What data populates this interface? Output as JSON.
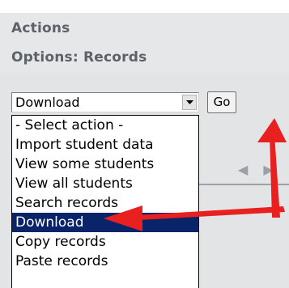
{
  "panel": {
    "title": "Actions",
    "subtitle": "Options: Records"
  },
  "action_select": {
    "current_value": "Download",
    "options": [
      "- Select action -",
      "Import student data",
      "View some students",
      "View all students",
      "Search records",
      "Download",
      "Copy records",
      "Paste records"
    ],
    "selected_index": 5
  },
  "go_button": {
    "label": "Go"
  },
  "colors": {
    "header_bg": "#e6e7e8",
    "header_text": "#5d6168",
    "selection_bg": "#0a246a",
    "annotation_arrow": "#e8201f"
  },
  "icons": {
    "dropdown": "chevron-down-icon",
    "annotation_go": "red-arrow-up-icon",
    "annotation_download": "red-arrow-left-icon"
  }
}
